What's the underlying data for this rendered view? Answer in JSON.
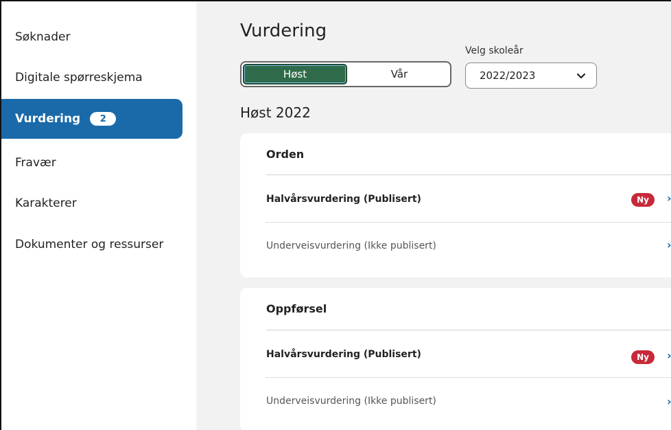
{
  "sidebar": {
    "items": [
      {
        "label": "Søknader"
      },
      {
        "label": "Digitale spørreskjema"
      },
      {
        "label": "Vurdering",
        "badge": "2",
        "active": true
      },
      {
        "label": "Fravær"
      },
      {
        "label": "Karakterer"
      },
      {
        "label": "Dokumenter og ressurser"
      }
    ]
  },
  "main": {
    "title": "Vurdering",
    "semester_toggle": [
      "Høst",
      "Vår"
    ],
    "selected_semester": "Høst",
    "year_select": {
      "label": "Velg skoleår",
      "value": "2022/2023"
    },
    "section_title": "Høst 2022",
    "cards": [
      {
        "heading": "Orden",
        "rows": [
          {
            "label": "Halvårsvurdering (Publisert)",
            "badge": "Ny"
          },
          {
            "label": "Underveisvurdering (Ikke publisert)"
          }
        ]
      },
      {
        "heading": "Oppførsel",
        "rows": [
          {
            "label": "Halvårsvurdering (Publisert)",
            "badge": "Ny"
          },
          {
            "label": "Underveisvurdering (Ikke publisert)"
          }
        ]
      }
    ]
  },
  "colors": {
    "accent": "#1a6aa9",
    "selected_toggle": "#2f6b4a",
    "badge_new": "#c62a3a",
    "main_bg": "#f2f2f2"
  },
  "icons": {
    "select": "chevron-down-icon",
    "row": "chevron-right-icon"
  }
}
